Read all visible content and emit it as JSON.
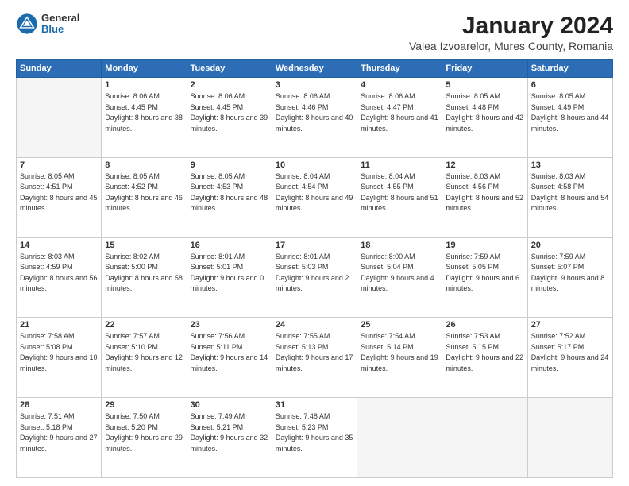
{
  "logo": {
    "general": "General",
    "blue": "Blue"
  },
  "title": "January 2024",
  "subtitle": "Valea Izvoarelor, Mures County, Romania",
  "headers": [
    "Sunday",
    "Monday",
    "Tuesday",
    "Wednesday",
    "Thursday",
    "Friday",
    "Saturday"
  ],
  "weeks": [
    [
      {
        "day": "",
        "sunrise": "",
        "sunset": "",
        "daylight": "",
        "empty": true
      },
      {
        "day": "1",
        "sunrise": "Sunrise: 8:06 AM",
        "sunset": "Sunset: 4:45 PM",
        "daylight": "Daylight: 8 hours and 38 minutes."
      },
      {
        "day": "2",
        "sunrise": "Sunrise: 8:06 AM",
        "sunset": "Sunset: 4:45 PM",
        "daylight": "Daylight: 8 hours and 39 minutes."
      },
      {
        "day": "3",
        "sunrise": "Sunrise: 8:06 AM",
        "sunset": "Sunset: 4:46 PM",
        "daylight": "Daylight: 8 hours and 40 minutes."
      },
      {
        "day": "4",
        "sunrise": "Sunrise: 8:06 AM",
        "sunset": "Sunset: 4:47 PM",
        "daylight": "Daylight: 8 hours and 41 minutes."
      },
      {
        "day": "5",
        "sunrise": "Sunrise: 8:05 AM",
        "sunset": "Sunset: 4:48 PM",
        "daylight": "Daylight: 8 hours and 42 minutes."
      },
      {
        "day": "6",
        "sunrise": "Sunrise: 8:05 AM",
        "sunset": "Sunset: 4:49 PM",
        "daylight": "Daylight: 8 hours and 44 minutes."
      }
    ],
    [
      {
        "day": "7",
        "sunrise": "Sunrise: 8:05 AM",
        "sunset": "Sunset: 4:51 PM",
        "daylight": "Daylight: 8 hours and 45 minutes."
      },
      {
        "day": "8",
        "sunrise": "Sunrise: 8:05 AM",
        "sunset": "Sunset: 4:52 PM",
        "daylight": "Daylight: 8 hours and 46 minutes."
      },
      {
        "day": "9",
        "sunrise": "Sunrise: 8:05 AM",
        "sunset": "Sunset: 4:53 PM",
        "daylight": "Daylight: 8 hours and 48 minutes."
      },
      {
        "day": "10",
        "sunrise": "Sunrise: 8:04 AM",
        "sunset": "Sunset: 4:54 PM",
        "daylight": "Daylight: 8 hours and 49 minutes."
      },
      {
        "day": "11",
        "sunrise": "Sunrise: 8:04 AM",
        "sunset": "Sunset: 4:55 PM",
        "daylight": "Daylight: 8 hours and 51 minutes."
      },
      {
        "day": "12",
        "sunrise": "Sunrise: 8:03 AM",
        "sunset": "Sunset: 4:56 PM",
        "daylight": "Daylight: 8 hours and 52 minutes."
      },
      {
        "day": "13",
        "sunrise": "Sunrise: 8:03 AM",
        "sunset": "Sunset: 4:58 PM",
        "daylight": "Daylight: 8 hours and 54 minutes."
      }
    ],
    [
      {
        "day": "14",
        "sunrise": "Sunrise: 8:03 AM",
        "sunset": "Sunset: 4:59 PM",
        "daylight": "Daylight: 8 hours and 56 minutes."
      },
      {
        "day": "15",
        "sunrise": "Sunrise: 8:02 AM",
        "sunset": "Sunset: 5:00 PM",
        "daylight": "Daylight: 8 hours and 58 minutes."
      },
      {
        "day": "16",
        "sunrise": "Sunrise: 8:01 AM",
        "sunset": "Sunset: 5:01 PM",
        "daylight": "Daylight: 9 hours and 0 minutes."
      },
      {
        "day": "17",
        "sunrise": "Sunrise: 8:01 AM",
        "sunset": "Sunset: 5:03 PM",
        "daylight": "Daylight: 9 hours and 2 minutes."
      },
      {
        "day": "18",
        "sunrise": "Sunrise: 8:00 AM",
        "sunset": "Sunset: 5:04 PM",
        "daylight": "Daylight: 9 hours and 4 minutes."
      },
      {
        "day": "19",
        "sunrise": "Sunrise: 7:59 AM",
        "sunset": "Sunset: 5:05 PM",
        "daylight": "Daylight: 9 hours and 6 minutes."
      },
      {
        "day": "20",
        "sunrise": "Sunrise: 7:59 AM",
        "sunset": "Sunset: 5:07 PM",
        "daylight": "Daylight: 9 hours and 8 minutes."
      }
    ],
    [
      {
        "day": "21",
        "sunrise": "Sunrise: 7:58 AM",
        "sunset": "Sunset: 5:08 PM",
        "daylight": "Daylight: 9 hours and 10 minutes."
      },
      {
        "day": "22",
        "sunrise": "Sunrise: 7:57 AM",
        "sunset": "Sunset: 5:10 PM",
        "daylight": "Daylight: 9 hours and 12 minutes."
      },
      {
        "day": "23",
        "sunrise": "Sunrise: 7:56 AM",
        "sunset": "Sunset: 5:11 PM",
        "daylight": "Daylight: 9 hours and 14 minutes."
      },
      {
        "day": "24",
        "sunrise": "Sunrise: 7:55 AM",
        "sunset": "Sunset: 5:13 PM",
        "daylight": "Daylight: 9 hours and 17 minutes."
      },
      {
        "day": "25",
        "sunrise": "Sunrise: 7:54 AM",
        "sunset": "Sunset: 5:14 PM",
        "daylight": "Daylight: 9 hours and 19 minutes."
      },
      {
        "day": "26",
        "sunrise": "Sunrise: 7:53 AM",
        "sunset": "Sunset: 5:15 PM",
        "daylight": "Daylight: 9 hours and 22 minutes."
      },
      {
        "day": "27",
        "sunrise": "Sunrise: 7:52 AM",
        "sunset": "Sunset: 5:17 PM",
        "daylight": "Daylight: 9 hours and 24 minutes."
      }
    ],
    [
      {
        "day": "28",
        "sunrise": "Sunrise: 7:51 AM",
        "sunset": "Sunset: 5:18 PM",
        "daylight": "Daylight: 9 hours and 27 minutes."
      },
      {
        "day": "29",
        "sunrise": "Sunrise: 7:50 AM",
        "sunset": "Sunset: 5:20 PM",
        "daylight": "Daylight: 9 hours and 29 minutes."
      },
      {
        "day": "30",
        "sunrise": "Sunrise: 7:49 AM",
        "sunset": "Sunset: 5:21 PM",
        "daylight": "Daylight: 9 hours and 32 minutes."
      },
      {
        "day": "31",
        "sunrise": "Sunrise: 7:48 AM",
        "sunset": "Sunset: 5:23 PM",
        "daylight": "Daylight: 9 hours and 35 minutes."
      },
      {
        "day": "",
        "sunrise": "",
        "sunset": "",
        "daylight": "",
        "empty": true
      },
      {
        "day": "",
        "sunrise": "",
        "sunset": "",
        "daylight": "",
        "empty": true
      },
      {
        "day": "",
        "sunrise": "",
        "sunset": "",
        "daylight": "",
        "empty": true
      }
    ]
  ]
}
